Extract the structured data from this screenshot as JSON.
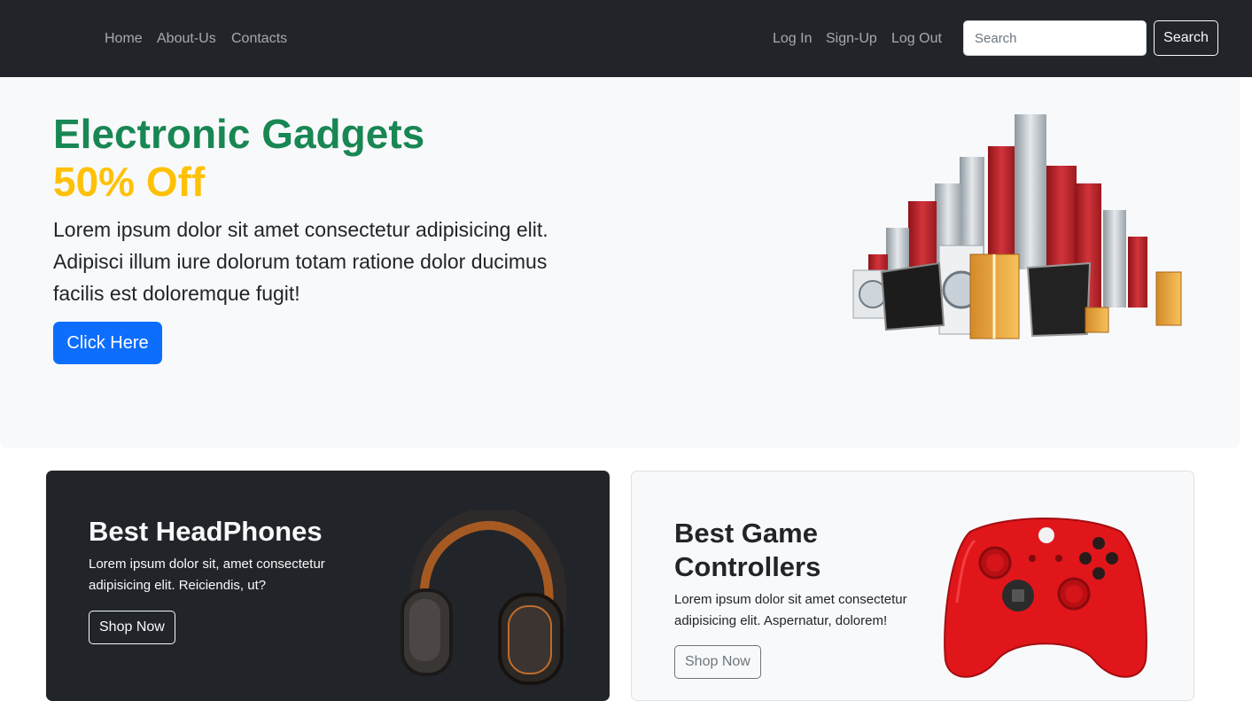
{
  "navbar": {
    "links": [
      "Home",
      "About-Us",
      "Contacts"
    ],
    "auth_links": [
      "Log In",
      "Sign-Up",
      "Log Out"
    ],
    "search_placeholder": "Search",
    "search_button": "Search"
  },
  "hero": {
    "title": "Electronic Gadgets",
    "subtitle": "50% Off",
    "text": "Lorem ipsum dolor sit amet consectetur adipisicing elit. Adipisci illum iure dolorum totam ratione dolor ducimus facilis est doloremque fugit!",
    "button": "Click Here"
  },
  "cards": [
    {
      "title": "Best HeadPhones",
      "text": "Lorem ipsum dolor sit, amet consectetur adipisicing elit. Reiciendis, ut?",
      "button": "Shop Now"
    },
    {
      "title": "Best Game Controllers",
      "text": "Lorem ipsum dolor sit amet consectetur adipisicing elit. Aspernatur, dolorem!",
      "button": "Shop Now"
    }
  ],
  "colors": {
    "navbar_bg": "#212529",
    "hero_title": "#198754",
    "hero_subtitle": "#ffc107",
    "primary_button": "#0d6efd",
    "light_bg": "#f8f9fa"
  }
}
